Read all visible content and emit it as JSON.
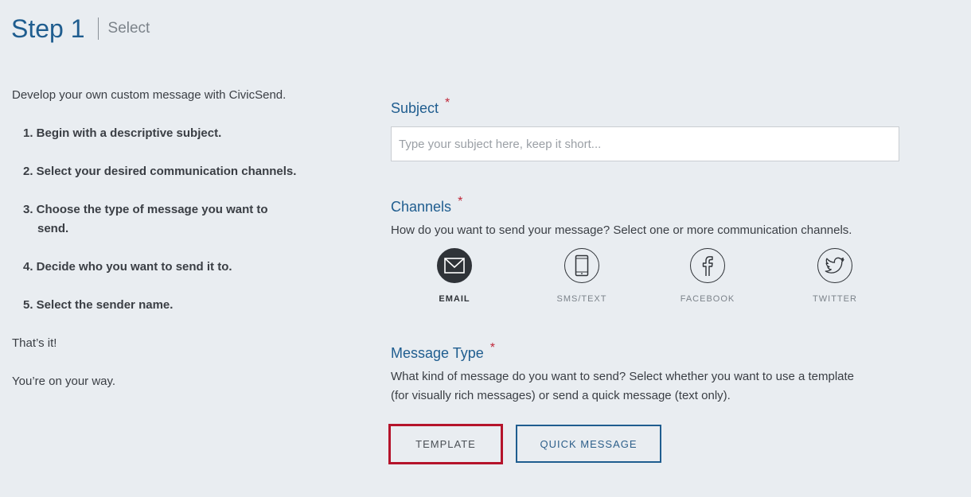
{
  "header": {
    "title": "Step 1",
    "subtitle": "Select"
  },
  "instructions": {
    "intro": "Develop your own custom message with CivicSend.",
    "steps": [
      "1. Begin with a descriptive subject.",
      "2. Select your desired communication channels.",
      "3. Choose the type of message you want to send.",
      "4. Decide who you want to send it to.",
      "5. Select the sender name."
    ],
    "outro1": "That’s it!",
    "outro2": "You’re on your way."
  },
  "subject": {
    "label": "Subject",
    "required_mark": "*",
    "placeholder": "Type your subject here, keep it short...",
    "value": ""
  },
  "channels": {
    "label": "Channels",
    "required_mark": "*",
    "description": "How do you want to send your message? Select one or more communication channels.",
    "items": [
      {
        "label": "EMAIL",
        "icon": "email-icon",
        "selected": true
      },
      {
        "label": "SMS/TEXT",
        "icon": "phone-icon",
        "selected": false
      },
      {
        "label": "FACEBOOK",
        "icon": "facebook-icon",
        "selected": false
      },
      {
        "label": "TWITTER",
        "icon": "twitter-icon",
        "selected": false
      }
    ]
  },
  "message_type": {
    "label": "Message Type",
    "required_mark": "*",
    "description": "What kind of message do you want to send? Select whether you want to use a template (for visually rich messages) or send a quick message (text only).",
    "template_label": "TEMPLATE",
    "quick_label": "QUICK MESSAGE"
  },
  "colors": {
    "background": "#e9edf1",
    "accent_blue": "#1f5d8f",
    "required_red": "#c0283a",
    "highlight_red": "#b5142b",
    "dark": "#2f3338"
  }
}
